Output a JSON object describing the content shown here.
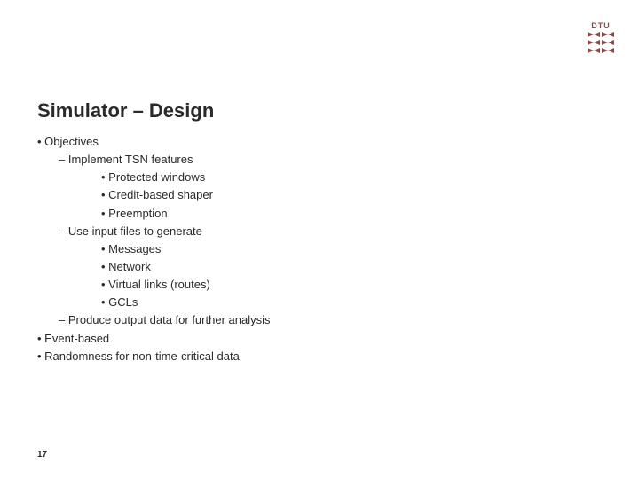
{
  "logo_text": "DTU",
  "title": "Simulator – Design",
  "bullets": {
    "b1": "• Objectives",
    "b2": "– Implement TSN features",
    "b3": "• Protected windows",
    "b4": "• Credit-based shaper",
    "b5": "• Preemption",
    "b6": "– Use input files to generate",
    "b7": "• Messages",
    "b8": "• Network",
    "b9": "• Virtual links (routes)",
    "b10": "• GCLs",
    "b11": "– Produce output data for further analysis",
    "b12": "• Event-based",
    "b13": "• Randomness for non-time-critical data"
  },
  "page_number": "17"
}
